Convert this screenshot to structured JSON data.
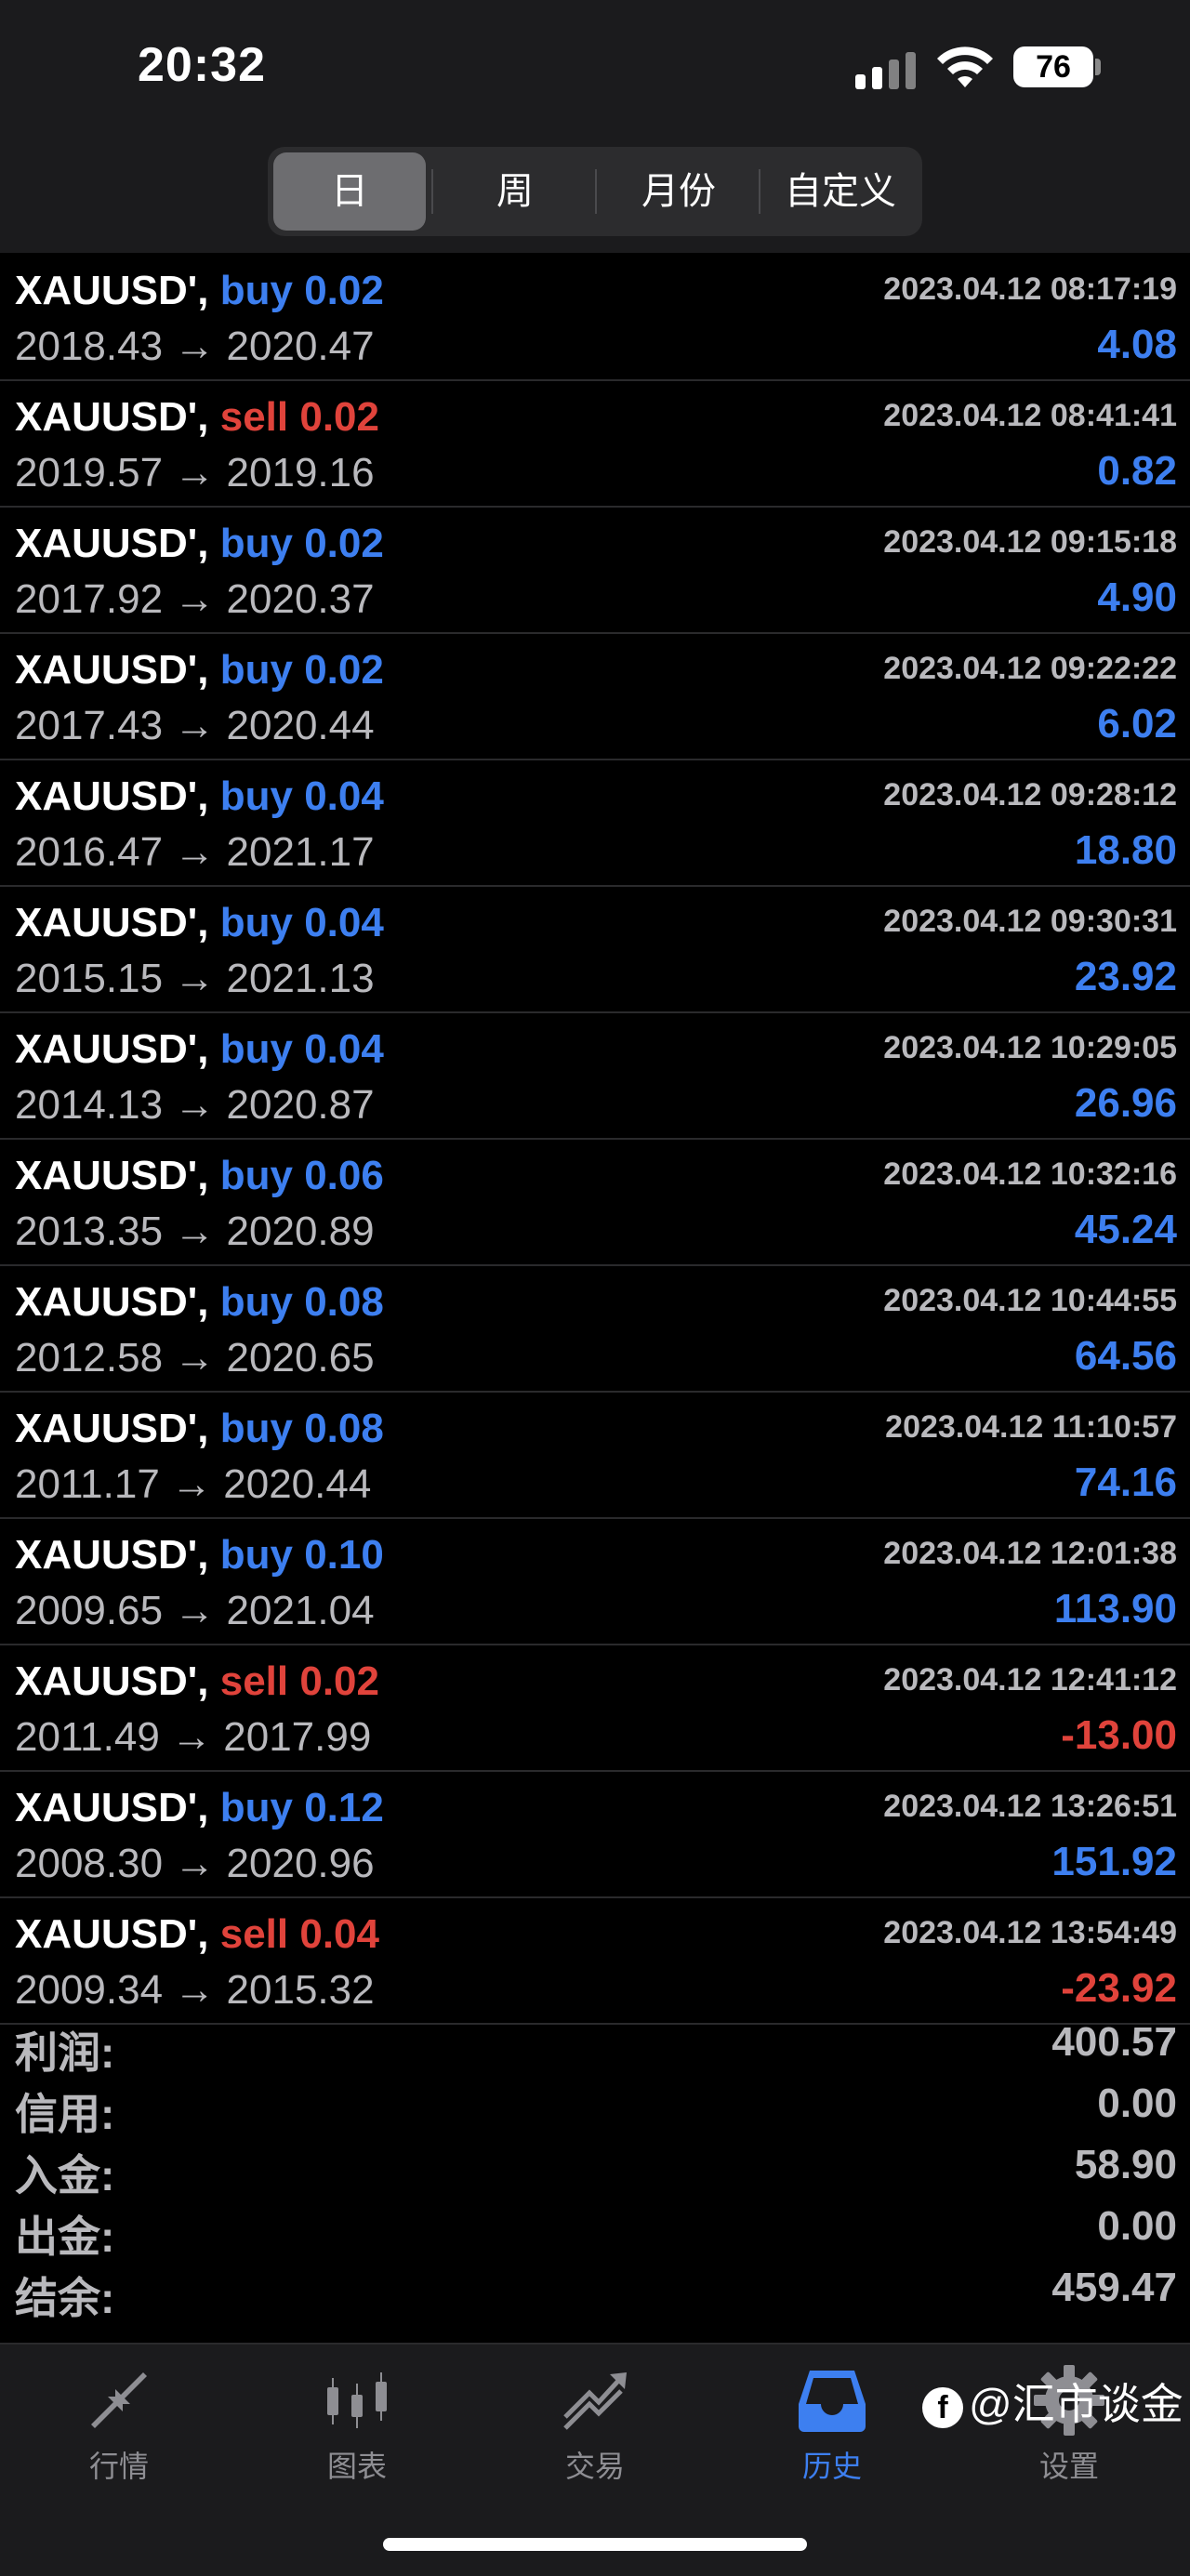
{
  "status_bar": {
    "time": "20:32",
    "battery": "76"
  },
  "segments": [
    {
      "label": "日",
      "active": true
    },
    {
      "label": "周",
      "active": false
    },
    {
      "label": "月份",
      "active": false
    },
    {
      "label": "自定义",
      "active": false
    }
  ],
  "trades": [
    {
      "symbol": "XAUUSD',",
      "side": "buy",
      "lot": "0.02",
      "datetime": "2023.04.12 08:17:19",
      "open": "2018.43",
      "close": "2020.47",
      "profit": "4.08"
    },
    {
      "symbol": "XAUUSD',",
      "side": "sell",
      "lot": "0.02",
      "datetime": "2023.04.12 08:41:41",
      "open": "2019.57",
      "close": "2019.16",
      "profit": "0.82"
    },
    {
      "symbol": "XAUUSD',",
      "side": "buy",
      "lot": "0.02",
      "datetime": "2023.04.12 09:15:18",
      "open": "2017.92",
      "close": "2020.37",
      "profit": "4.90"
    },
    {
      "symbol": "XAUUSD',",
      "side": "buy",
      "lot": "0.02",
      "datetime": "2023.04.12 09:22:22",
      "open": "2017.43",
      "close": "2020.44",
      "profit": "6.02"
    },
    {
      "symbol": "XAUUSD',",
      "side": "buy",
      "lot": "0.04",
      "datetime": "2023.04.12 09:28:12",
      "open": "2016.47",
      "close": "2021.17",
      "profit": "18.80"
    },
    {
      "symbol": "XAUUSD',",
      "side": "buy",
      "lot": "0.04",
      "datetime": "2023.04.12 09:30:31",
      "open": "2015.15",
      "close": "2021.13",
      "profit": "23.92"
    },
    {
      "symbol": "XAUUSD',",
      "side": "buy",
      "lot": "0.04",
      "datetime": "2023.04.12 10:29:05",
      "open": "2014.13",
      "close": "2020.87",
      "profit": "26.96"
    },
    {
      "symbol": "XAUUSD',",
      "side": "buy",
      "lot": "0.06",
      "datetime": "2023.04.12 10:32:16",
      "open": "2013.35",
      "close": "2020.89",
      "profit": "45.24"
    },
    {
      "symbol": "XAUUSD',",
      "side": "buy",
      "lot": "0.08",
      "datetime": "2023.04.12 10:44:55",
      "open": "2012.58",
      "close": "2020.65",
      "profit": "64.56"
    },
    {
      "symbol": "XAUUSD',",
      "side": "buy",
      "lot": "0.08",
      "datetime": "2023.04.12 11:10:57",
      "open": "2011.17",
      "close": "2020.44",
      "profit": "74.16"
    },
    {
      "symbol": "XAUUSD',",
      "side": "buy",
      "lot": "0.10",
      "datetime": "2023.04.12 12:01:38",
      "open": "2009.65",
      "close": "2021.04",
      "profit": "113.90"
    },
    {
      "symbol": "XAUUSD',",
      "side": "sell",
      "lot": "0.02",
      "datetime": "2023.04.12 12:41:12",
      "open": "2011.49",
      "close": "2017.99",
      "profit": "-13.00"
    },
    {
      "symbol": "XAUUSD',",
      "side": "buy",
      "lot": "0.12",
      "datetime": "2023.04.12 13:26:51",
      "open": "2008.30",
      "close": "2020.96",
      "profit": "151.92"
    },
    {
      "symbol": "XAUUSD',",
      "side": "sell",
      "lot": "0.04",
      "datetime": "2023.04.12 13:54:49",
      "open": "2009.34",
      "close": "2015.32",
      "profit": "-23.92"
    }
  ],
  "arrow": "→",
  "summary": [
    {
      "label": "利润:",
      "value": "400.57"
    },
    {
      "label": "信用:",
      "value": "0.00"
    },
    {
      "label": "入金:",
      "value": "58.90"
    },
    {
      "label": "出金:",
      "value": "0.00"
    },
    {
      "label": "结余:",
      "value": "459.47"
    }
  ],
  "tabs": [
    {
      "label": "行情",
      "icon": "quotes-icon"
    },
    {
      "label": "图表",
      "icon": "chart-icon"
    },
    {
      "label": "交易",
      "icon": "trade-icon"
    },
    {
      "label": "历史",
      "icon": "history-icon",
      "active": true
    },
    {
      "label": "设置",
      "icon": "gear-icon"
    }
  ],
  "watermark": {
    "text": "@汇市谈金",
    "logo_letter": "f"
  },
  "colors": {
    "buy": "#3d7ff0",
    "sell": "#e0433b",
    "active_tab": "#3d7ff0",
    "inactive": "#8e8e93"
  }
}
